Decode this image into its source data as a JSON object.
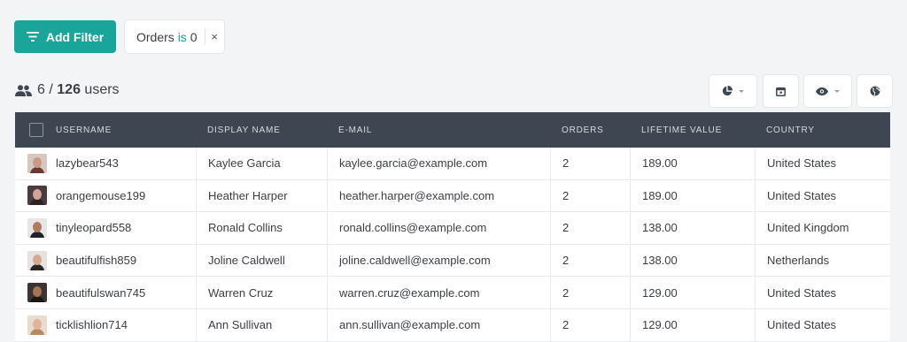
{
  "toolbar": {
    "add_filter_label": "Add Filter",
    "filter_chip": {
      "field": "Orders",
      "operator": "is",
      "value": "0",
      "close": "×"
    }
  },
  "summary": {
    "shown": "6",
    "separator": "/",
    "total": "126",
    "unit": "users"
  },
  "tools": [
    {
      "icon": "pie-chart-icon",
      "has_dropdown": true
    },
    {
      "icon": "calendar-icon",
      "has_dropdown": false
    },
    {
      "icon": "eye-icon",
      "has_dropdown": true
    },
    {
      "icon": "globe-icon",
      "has_dropdown": false
    }
  ],
  "table": {
    "columns": [
      "USERNAME",
      "DISPLAY NAME",
      "E-MAIL",
      "ORDERS",
      "LIFETIME VALUE",
      "COUNTRY"
    ],
    "rows": [
      {
        "username": "lazybear543",
        "display_name": "Kaylee Garcia",
        "email": "kaylee.garcia@example.com",
        "orders": "2",
        "lifetime_value": "189.00",
        "country": "United States",
        "avatar": {
          "bg": "#d8c6c0",
          "face": "#c99a86",
          "body": "#6b3b33"
        }
      },
      {
        "username": "orangemouse199",
        "display_name": "Heather Harper",
        "email": "heather.harper@example.com",
        "orders": "2",
        "lifetime_value": "189.00",
        "country": "United States",
        "avatar": {
          "bg": "#4a3a42",
          "face": "#d2a596",
          "body": "#2d2226"
        }
      },
      {
        "username": "tinyleopard558",
        "display_name": "Ronald Collins",
        "email": "ronald.collins@example.com",
        "orders": "2",
        "lifetime_value": "138.00",
        "country": "United Kingdom",
        "avatar": {
          "bg": "#e8e6e4",
          "face": "#b27a5f",
          "body": "#1e2230"
        }
      },
      {
        "username": "beautifulfish859",
        "display_name": "Joline Caldwell",
        "email": "joline.caldwell@example.com",
        "orders": "2",
        "lifetime_value": "138.00",
        "country": "Netherlands",
        "avatar": {
          "bg": "#e6e2df",
          "face": "#d9a893",
          "body": "#2a2624"
        }
      },
      {
        "username": "beautifulswan745",
        "display_name": "Warren Cruz",
        "email": "warren.cruz@example.com",
        "orders": "2",
        "lifetime_value": "129.00",
        "country": "United States",
        "avatar": {
          "bg": "#3b3430",
          "face": "#a87258",
          "body": "#1b1715"
        }
      },
      {
        "username": "ticklishlion714",
        "display_name": "Ann Sullivan",
        "email": "ann.sullivan@example.com",
        "orders": "2",
        "lifetime_value": "129.00",
        "country": "United States",
        "avatar": {
          "bg": "#e9dccf",
          "face": "#e2b59a",
          "body": "#b98a5e"
        }
      }
    ]
  },
  "colors": {
    "accent": "#1aa59a",
    "header_bg": "#3e4651",
    "page_bg": "#f3f4f5"
  }
}
